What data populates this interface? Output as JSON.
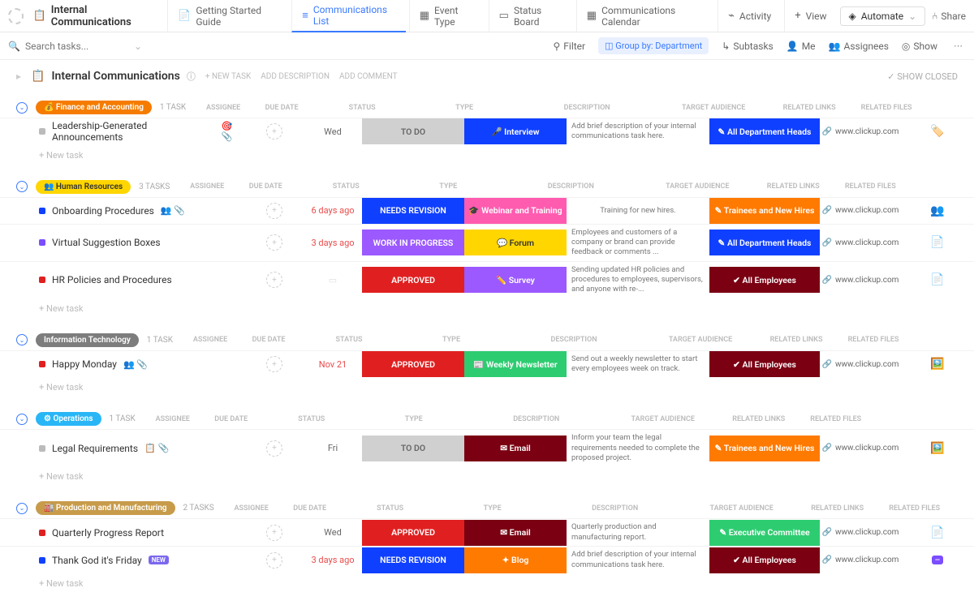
{
  "page": {
    "title": "Internal Communications"
  },
  "tabs": [
    {
      "label": "Getting Started Guide",
      "icon": "📄"
    },
    {
      "label": "Communications List",
      "icon": "≡",
      "active": true
    },
    {
      "label": "Event Type",
      "icon": "▦"
    },
    {
      "label": "Status Board",
      "icon": "▭"
    },
    {
      "label": "Communications Calendar",
      "icon": "▦"
    },
    {
      "label": "Activity",
      "icon": "⌁"
    },
    {
      "label": "View",
      "icon": "+"
    }
  ],
  "topRight": {
    "automate": "Automate",
    "share": "Share"
  },
  "search": {
    "placeholder": "Search tasks..."
  },
  "subRight": {
    "filter": "Filter",
    "group": "Group by: Department",
    "subtasks": "Subtasks",
    "me": "Me",
    "assignees": "Assignees",
    "show": "Show"
  },
  "listHeader": {
    "title": "Internal Communications",
    "newTask": "+ NEW TASK",
    "addDesc": "ADD DESCRIPTION",
    "addComment": "ADD COMMENT",
    "showClosed": "SHOW CLOSED"
  },
  "colHeaders": {
    "assignee": "ASSIGNEE",
    "due": "DUE DATE",
    "status": "STATUS",
    "type": "TYPE",
    "desc": "DESCRIPTION",
    "aud": "TARGET AUDIENCE",
    "links": "RELATED LINKS",
    "files": "RELATED FILES"
  },
  "newTask": "+ New task",
  "groups": [
    {
      "label": "Finance and Accounting",
      "color": "#f57c00",
      "icon": "💰",
      "count": "1 TASK",
      "rows": [
        {
          "sq": "#bbb",
          "name": "Leadership-Generated Announcements",
          "icons": "🎯 📎",
          "due": "Wed",
          "dueRed": false,
          "status": {
            "text": "TO DO",
            "bg": "#d0d0d0",
            "fg": "#666"
          },
          "type": {
            "text": "Interview",
            "icon": "🎤",
            "bg": "#1040ff"
          },
          "desc": "Add brief description of your internal communications task here.",
          "aud": {
            "text": "All Department Heads",
            "icon": "✎",
            "bg": "#1040ff"
          },
          "link": "www.clickup.com",
          "file": "🏷️"
        }
      ]
    },
    {
      "label": "Human Resources",
      "color": "#ffd600",
      "fg": "#333",
      "icon": "👥",
      "count": "3 TASKS",
      "rows": [
        {
          "sq": "#1040ff",
          "name": "Onboarding Procedures",
          "icons": "👥 📎",
          "due": "6 days ago",
          "dueRed": true,
          "status": {
            "text": "NEEDS REVISION",
            "bg": "#1040ff"
          },
          "type": {
            "text": "Webinar and Training",
            "icon": "🎓",
            "bg": "#ff5cb0"
          },
          "desc": "Training for new hires.",
          "aud": {
            "text": "Trainees and New Hires",
            "icon": "✎",
            "bg": "#ff7a00"
          },
          "link": "www.clickup.com",
          "file": "👥"
        },
        {
          "sq": "#7b4dff",
          "name": "Virtual Suggestion Boxes",
          "icons": "",
          "due": "3 days ago",
          "dueRed": true,
          "status": {
            "text": "WORK IN PROGRESS",
            "bg": "#9b59ff"
          },
          "type": {
            "text": "Forum",
            "icon": "💬",
            "bg": "#ffd600",
            "fg": "#333"
          },
          "desc": "Employees and customers of a company or brand can provide feedback or comments ...",
          "aud": {
            "text": "All Department Heads",
            "icon": "✎",
            "bg": "#1040ff"
          },
          "link": "www.clickup.com",
          "file": "📄"
        },
        {
          "sq": "#e02020",
          "name": "HR Policies and Procedures",
          "icons": "",
          "due": "",
          "dueRed": false,
          "status": {
            "text": "APPROVED",
            "bg": "#e02020"
          },
          "type": {
            "text": "Survey",
            "icon": "✏️",
            "bg": "#9b59ff"
          },
          "desc": "Sending updated HR policies and procedures to employees, supervisors, and anyone with re-...",
          "aud": {
            "text": "All Employees",
            "icon": "✔",
            "bg": "#7a0012"
          },
          "link": "www.clickup.com",
          "file": "📄"
        }
      ]
    },
    {
      "label": "Information Technology",
      "color": "#7d7d7d",
      "icon": "",
      "count": "1 TASK",
      "rows": [
        {
          "sq": "#e02020",
          "name": "Happy Monday",
          "icons": "👥 📎",
          "due": "Nov 21",
          "dueRed": true,
          "status": {
            "text": "APPROVED",
            "bg": "#e02020"
          },
          "type": {
            "text": "Weekly Newsletter",
            "icon": "📰",
            "bg": "#2ecc71"
          },
          "desc": "Send out a weekly newsletter to start every employees week on track.",
          "aud": {
            "text": "All Employees",
            "icon": "✔",
            "bg": "#7a0012"
          },
          "link": "www.clickup.com",
          "file": "🖼️"
        }
      ]
    },
    {
      "label": "Operations",
      "color": "#29b6f6",
      "icon": "⚙",
      "count": "1 TASK",
      "rows": [
        {
          "sq": "#bbb",
          "name": "Legal Requirements",
          "icons": "📋 📎",
          "due": "Fri",
          "dueRed": false,
          "status": {
            "text": "TO DO",
            "bg": "#d0d0d0",
            "fg": "#666"
          },
          "type": {
            "text": "Email",
            "icon": "✉",
            "bg": "#7a0012"
          },
          "desc": "Inform your team the legal requirements needed to complete the proposed project.",
          "aud": {
            "text": "Trainees and New Hires",
            "icon": "✎",
            "bg": "#ff7a00"
          },
          "link": "www.clickup.com",
          "file": "🖼️"
        }
      ]
    },
    {
      "label": "Production and Manufacturing",
      "color": "#c79b4a",
      "icon": "🏭",
      "count": "2 TASKS",
      "rows": [
        {
          "sq": "#e02020",
          "name": "Quarterly Progress Report",
          "icons": "",
          "due": "Wed",
          "dueRed": false,
          "status": {
            "text": "APPROVED",
            "bg": "#e02020"
          },
          "type": {
            "text": "Email",
            "icon": "✉",
            "bg": "#7a0012"
          },
          "desc": "Quarterly production and manufacturing report.",
          "aud": {
            "text": "Executive Committee",
            "icon": "✎",
            "bg": "#2ecc71"
          },
          "link": "www.clickup.com",
          "file": "📄"
        },
        {
          "sq": "#1040ff",
          "name": "Thank God it's Friday",
          "icons": "",
          "badge": "NEW",
          "due": "3 days ago",
          "dueRed": true,
          "status": {
            "text": "NEEDS REVISION",
            "bg": "#1040ff"
          },
          "type": {
            "text": "Blog",
            "icon": "✦",
            "bg": "#ff7a00"
          },
          "desc": "Add brief description of your internal communications task here.",
          "aud": {
            "text": "All Employees",
            "icon": "✔",
            "bg": "#7a0012"
          },
          "link": "www.clickup.com",
          "file": "",
          "fileBadge": true
        }
      ]
    }
  ]
}
